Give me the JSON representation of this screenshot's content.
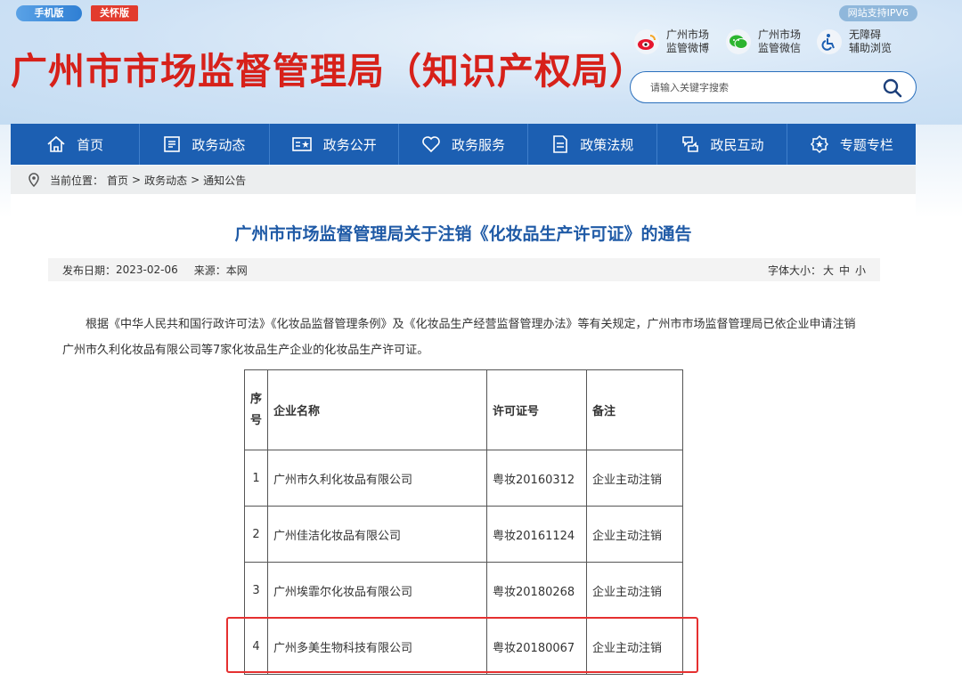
{
  "header": {
    "mobile_label": "手机版",
    "care_label": "关怀版",
    "ipv6_label": "网站支持IPV6",
    "site_title": "广州市市场监督管理局（知识产权局）",
    "weibo_line1": "广州市场",
    "weibo_line2": "监管微博",
    "wechat_line1": "广州市场",
    "wechat_line2": "监管微信",
    "access_line1": "无障碍",
    "access_line2": "辅助浏览",
    "search_placeholder": "请输入关键字搜索"
  },
  "nav": {
    "items": [
      "首页",
      "政务动态",
      "政务公开",
      "政务服务",
      "政策法规",
      "政民互动",
      "专题专栏"
    ]
  },
  "breadcrumb": {
    "label": "当前位置：",
    "home": "首页",
    "sep": ">",
    "section": "政务动态",
    "current": "通知公告"
  },
  "article": {
    "title": "广州市市场监督管理局关于注销《化妆品生产许可证》的通告",
    "date_label": "发布日期：",
    "date": "2023-02-06",
    "source_label": "来源：",
    "source": "本网",
    "font_size_label": "字体大小：",
    "font_large": "大",
    "font_medium": "中",
    "font_small": "小",
    "paragraph": "根据《中华人民共和国行政许可法》《化妆品监督管理条例》及《化妆品生产经营监督管理办法》等有关规定，广州市市场监督管理局已依企业申请注销广州市久利化妆品有限公司等7家化妆品生产企业的化妆品生产许可证。"
  },
  "table": {
    "headers": [
      "序号",
      "企业名称",
      "许可证号",
      "备注"
    ],
    "rows": [
      [
        "1",
        "广州市久利化妆品有限公司",
        "粤妆20160312",
        "企业主动注销"
      ],
      [
        "2",
        "广州佳洁化妆品有限公司",
        "粤妆20161124",
        "企业主动注销"
      ],
      [
        "3",
        "广州埃霏尔化妆品有限公司",
        "粤妆20180268",
        "企业主动注销"
      ],
      [
        "4",
        "广州多美生物科技有限公司",
        "粤妆20180067",
        "企业主动注销"
      ]
    ]
  },
  "colors": {
    "title_red": "#d7211a",
    "nav_blue": "#1c5fb2",
    "article_title_blue": "#1f5aa6",
    "highlight_red": "#e53030"
  }
}
